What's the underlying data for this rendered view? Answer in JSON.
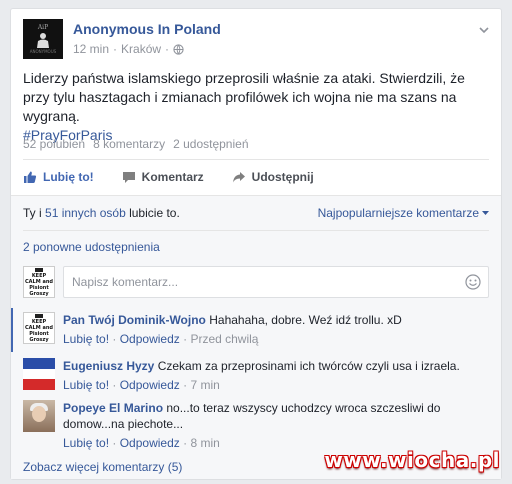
{
  "post": {
    "page_name": "Anonymous In Poland",
    "time": "12 min",
    "location": "Kraków",
    "separator": "·",
    "text": "Liderzy państwa islamskiego przeprosili właśnie za ataki. Stwierdzili, że przy tylu hasztagach i zmianach profilówek ich wojna nie ma szans na wygraną.",
    "hashtag": "#PrayForParis",
    "avatar_top": "AiP",
    "avatar_bottom": "ANONYMOUS",
    "stats": {
      "likes": "52 polubień",
      "comments": "8 komentarzy",
      "shares": "2 udostępnień"
    }
  },
  "actions": {
    "like": "Lubię to!",
    "comment": "Komentarz",
    "share": "Udostępnij",
    "colors": {
      "liked": "#4267b2",
      "default": "#4b4f56"
    }
  },
  "likes_summary": {
    "prefix": "Ty i",
    "others": "51 innych osób",
    "suffix": "lubicie to."
  },
  "sort_label": "Najpopularniejsze komentarze",
  "reshares": "2 ponowne udostępnienia",
  "composer": {
    "placeholder": "Napisz komentarz...",
    "avatar_text": "KEEP CALM and Pisiont Groszy"
  },
  "comments": [
    {
      "author": "Pan Twój Dominik-Wojno",
      "text": "Hahahaha, dobre. Weź idź trollu. xD",
      "like": "Lubię to!",
      "reply": "Odpowiedz",
      "time": "Przed chwilą",
      "avatar": "keep-calm-avatar"
    },
    {
      "author": "Eugeniusz Hyzy",
      "text": "Czekam za przeprosinami ich twórców czyli usa i izraela.",
      "like": "Lubię to!",
      "reply": "Odpowiedz",
      "time": "7 min",
      "avatar": "tricolor-flag-avatar"
    },
    {
      "author": "Popeye El Marino",
      "text": "no...to teraz wszyscy uchodzcy wroca szczesliwi do domow...na piechote...",
      "like": "Lubię to!",
      "reply": "Odpowiedz",
      "time": "8 min",
      "avatar": "portrait-avatar"
    }
  ],
  "more_comments": "Zobacz więcej komentarzy (5)",
  "watermark": "www.wiocha.pl"
}
